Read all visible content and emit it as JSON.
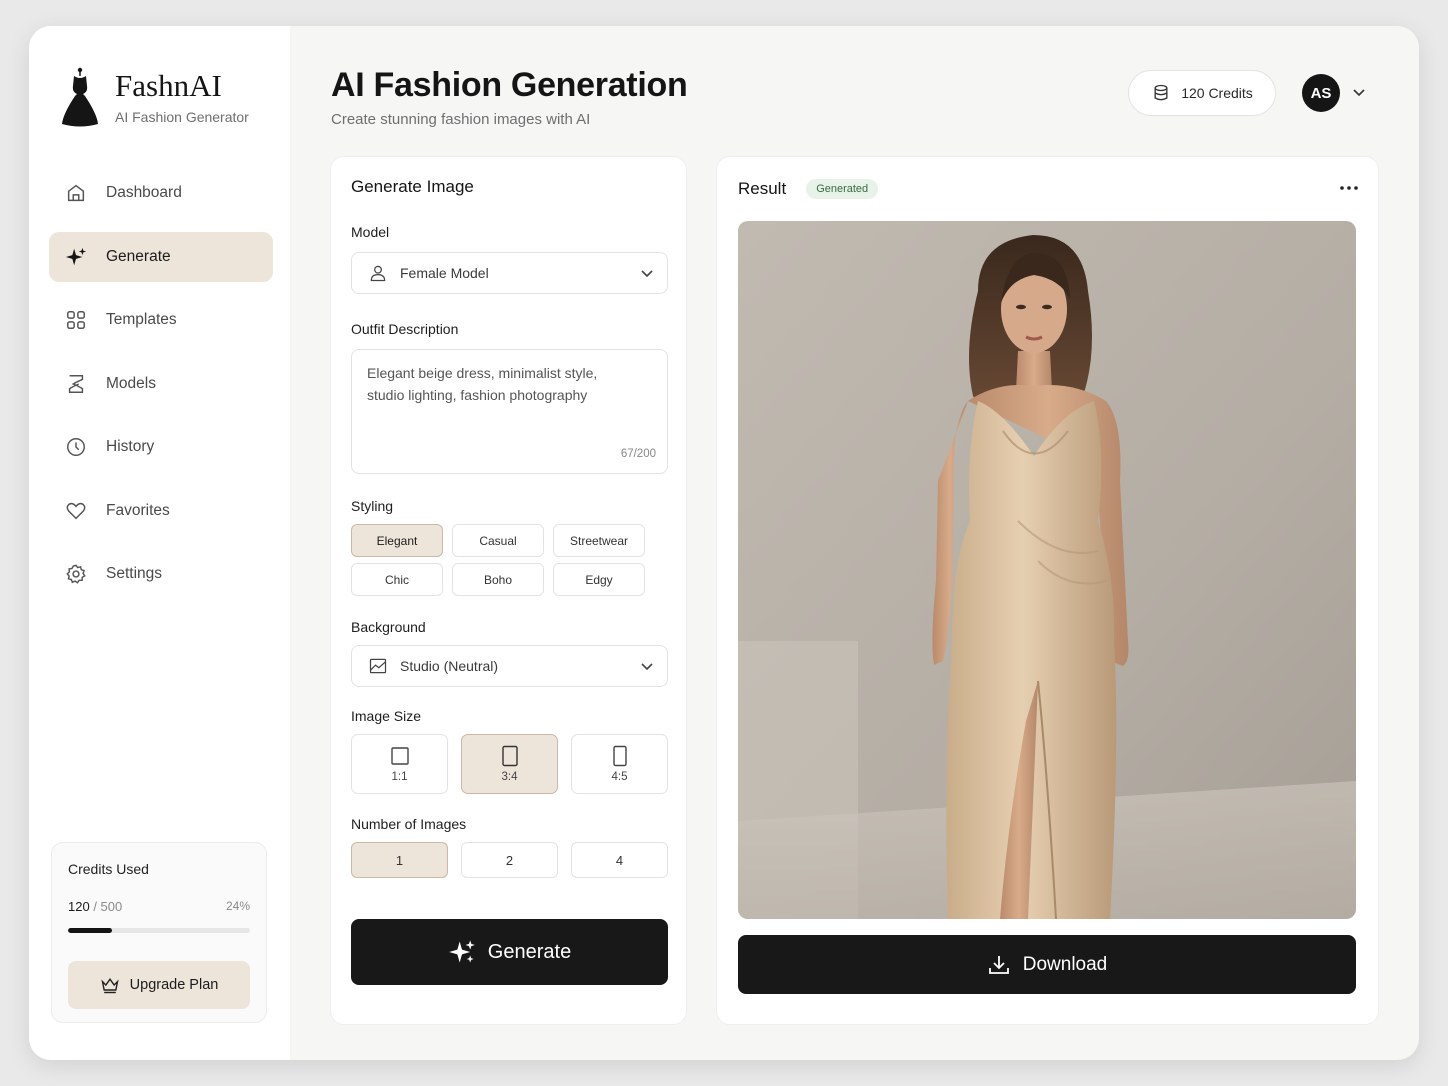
{
  "brand": {
    "name": "FashnAI",
    "subtitle": "AI Fashion Generator"
  },
  "nav": [
    {
      "label": "Dashboard",
      "icon": "home-icon",
      "active": false
    },
    {
      "label": "Generate",
      "icon": "sparkle-icon",
      "active": true
    },
    {
      "label": "Templates",
      "icon": "grid-icon",
      "active": false
    },
    {
      "label": "Models",
      "icon": "model-icon",
      "active": false
    },
    {
      "label": "History",
      "icon": "clock-icon",
      "active": false
    },
    {
      "label": "Favorites",
      "icon": "heart-icon",
      "active": false
    },
    {
      "label": "Settings",
      "icon": "gear-icon",
      "active": false
    }
  ],
  "credits_card": {
    "title": "Credits Used",
    "used": "120",
    "total": "/ 500",
    "percent_label": "24%",
    "fraction": 0.24,
    "upgrade_label": "Upgrade Plan"
  },
  "header": {
    "title": "AI Fashion Generation",
    "subtitle": "Create stunning fashion images with AI",
    "credits": "120 Credits",
    "avatar": "AS"
  },
  "generate_panel": {
    "title": "Generate Image",
    "model_label": "Model",
    "model_value": "Female Model",
    "outfit_label": "Outfit Description",
    "outfit_text": "Elegant beige dress, minimalist style, studio lighting, fashion photography",
    "outfit_count": "67/200",
    "styling_label": "Styling",
    "styles": [
      {
        "label": "Elegant",
        "active": true
      },
      {
        "label": "Casual",
        "active": false
      },
      {
        "label": "Streetwear",
        "active": false
      },
      {
        "label": "Chic",
        "active": false
      },
      {
        "label": "Boho",
        "active": false
      },
      {
        "label": "Edgy",
        "active": false
      }
    ],
    "background_label": "Background",
    "background_value": "Studio (Neutral)",
    "size_label": "Image Size",
    "sizes": [
      {
        "label": "1:1",
        "active": false
      },
      {
        "label": "3:4",
        "active": true
      },
      {
        "label": "4:5",
        "active": false
      }
    ],
    "count_label": "Number of Images",
    "counts": [
      {
        "label": "1",
        "active": true
      },
      {
        "label": "2",
        "active": false
      },
      {
        "label": "4",
        "active": false
      }
    ],
    "generate_label": "Generate"
  },
  "result_panel": {
    "title": "Result",
    "badge": "Generated",
    "download_label": "Download"
  },
  "colors": {
    "accent": "#ede4da",
    "dark": "#181818",
    "badge_bg": "#e7f2e8",
    "badge_text": "#3b6b43"
  }
}
